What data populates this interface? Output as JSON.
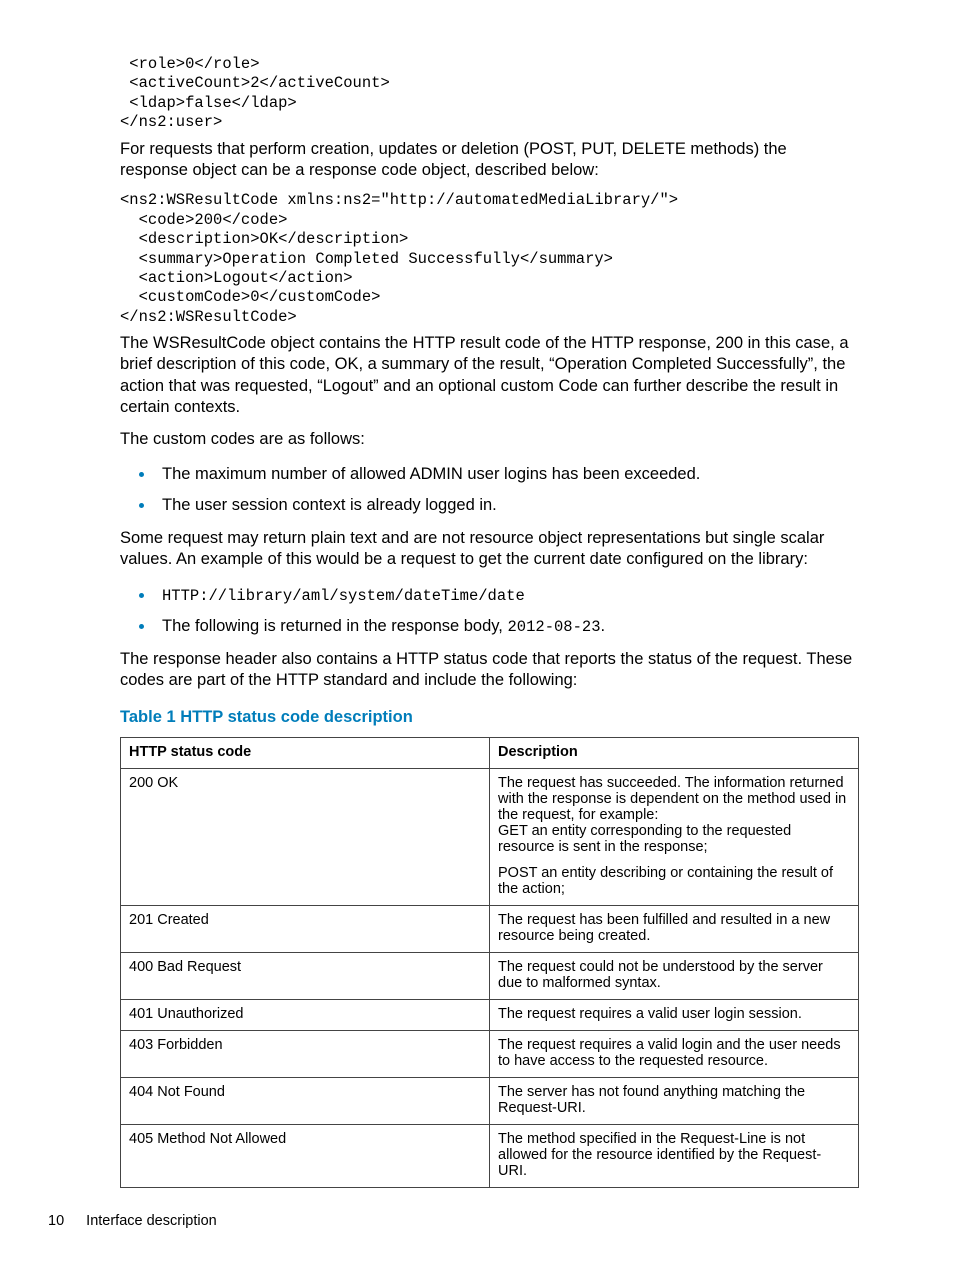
{
  "code_block_1": " <role>0</role>\n <activeCount>2</activeCount>\n <ldap>false</ldap>\n</ns2:user>",
  "para_1": "For requests that perform creation, updates or deletion (POST, PUT, DELETE methods) the response object can be a response code object, described below:",
  "code_block_2": "<ns2:WSResultCode xmlns:ns2=\"http://automatedMediaLibrary/\">\n  <code>200</code>\n  <description>OK</description>\n  <summary>Operation Completed Successfully</summary>\n  <action>Logout</action>\n  <customCode>0</customCode>\n</ns2:WSResultCode>",
  "para_2": "The WSResultCode object contains the HTTP result code of the HTTP response, 200 in this case, a brief description of this code, OK, a summary of the result, “Operation Completed Successfully”, the action that was requested, “Logout” and an optional custom Code can further describe the result in certain contexts.",
  "para_3": "The custom codes are as follows:",
  "bullets_1": [
    "The maximum number of allowed ADMIN user logins has been exceeded.",
    "The user session context is already logged in."
  ],
  "para_4": "Some request may return plain text and are not resource object representations but single scalar values. An example of this would be a request to get the current date configured on the library:",
  "bullet2_item1_code": "HTTP://library/aml/system/dateTime/date",
  "bullet2_item2_pre": "The following is returned in the response body, ",
  "bullet2_item2_code": "2012-08-23",
  "bullet2_item2_post": ".",
  "para_5": "The response header also contains a HTTP status code that reports the status of the request. These codes are part of the HTTP standard and include the following:",
  "table_title": "Table 1 HTTP status code description",
  "table": {
    "headers": [
      "HTTP status code",
      "Description"
    ],
    "rows": [
      {
        "code": "200 OK",
        "desc": [
          "The request has succeeded. The information returned with the response is dependent on the method used in the request, for example:\nGET an entity corresponding to the requested resource is sent in the response;",
          "POST an entity describing or containing the result of the action;"
        ]
      },
      {
        "code": "201 Created",
        "desc": [
          "The request has been fulfilled and resulted in a new resource being created."
        ]
      },
      {
        "code": "400 Bad Request",
        "desc": [
          "The request could not be understood by the server due to malformed syntax."
        ]
      },
      {
        "code": "401 Unauthorized",
        "desc": [
          "The request requires a valid user login session."
        ]
      },
      {
        "code": "403 Forbidden",
        "desc": [
          "The request requires a valid login and the user needs to have access to the requested resource."
        ]
      },
      {
        "code": "404 Not Found",
        "desc": [
          "The server has not found anything matching the Request-URI."
        ]
      },
      {
        "code": "405 Method Not Allowed",
        "desc": [
          "The method specified in the Request-Line is not allowed for the resource identified by the Request-URI."
        ]
      }
    ]
  },
  "footer": {
    "page_number": "10",
    "section": "Interface description"
  }
}
